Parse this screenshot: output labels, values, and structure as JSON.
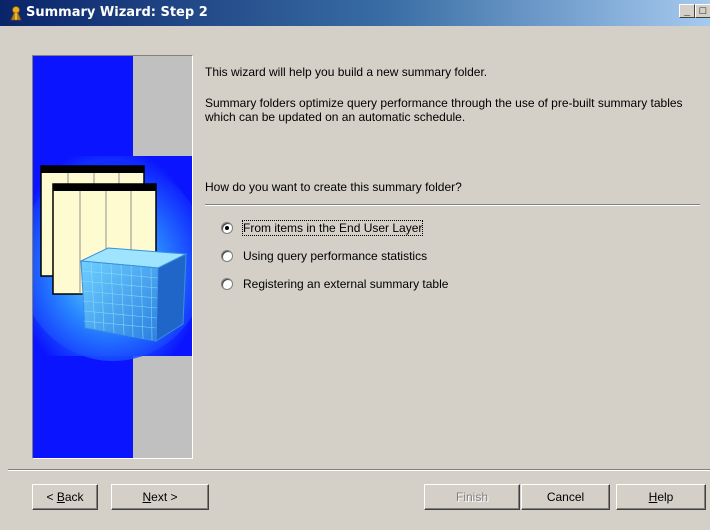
{
  "window": {
    "title": "Summary Wizard: Step 2"
  },
  "content": {
    "intro": "This wizard will help you build a new summary folder.",
    "description": "Summary folders optimize query performance through the use of pre-built summary tables which can be updated on an automatic schedule.",
    "question": "How do you want to create this summary folder?"
  },
  "options": [
    {
      "label": "From items in the End User Layer",
      "selected": true
    },
    {
      "label": "Using query performance statistics",
      "selected": false
    },
    {
      "label": "Registering an external summary table",
      "selected": false
    }
  ],
  "buttons": {
    "back": {
      "pre": "< ",
      "key": "B",
      "post": "ack"
    },
    "next": {
      "pre": "",
      "key": "N",
      "post": "ext >"
    },
    "finish": "Finish",
    "cancel": "Cancel",
    "help": {
      "key": "H",
      "post": "elp"
    }
  },
  "colors": {
    "titlebar_start": "#0a246a",
    "titlebar_end": "#a6caf0",
    "dialog_bg": "#d4d0c8",
    "panel_blue": "#0a14ff"
  }
}
